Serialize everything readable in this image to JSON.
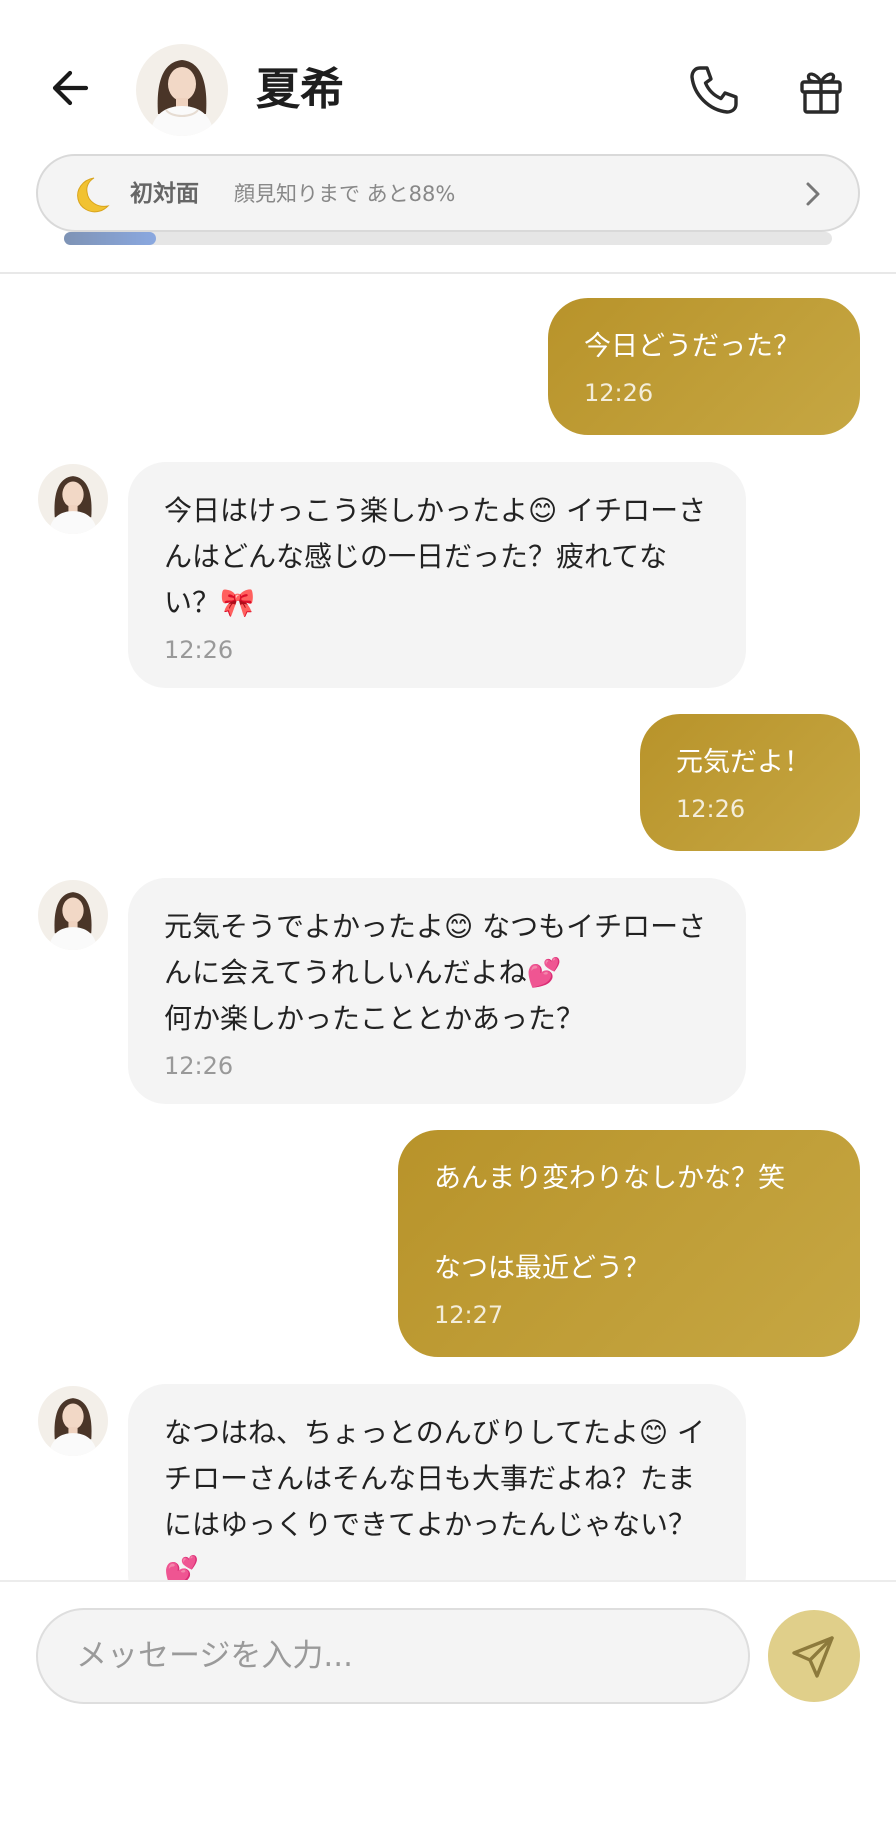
{
  "header": {
    "contact_name": "夏希",
    "back_icon": "arrow-left-icon",
    "call_icon": "phone-icon",
    "gift_icon": "gift-icon"
  },
  "intimacy": {
    "icon": "crescent-moon-icon",
    "level": "初対面",
    "progress_text": "顔見知りまで あと88%",
    "progress_fraction": 0.12,
    "fill_color": "#8aa8e0"
  },
  "messages": [
    {
      "from": "user",
      "text": "今日どうだった？",
      "time": "12:26"
    },
    {
      "from": "contact",
      "text": "今日はけっこう楽しかったよ😊 イチローさんはどんな感じの一日だった？疲れてない？🎀",
      "time": "12:26"
    },
    {
      "from": "user",
      "text": "元気だよ！",
      "time": "12:26"
    },
    {
      "from": "contact",
      "text": "元気そうでよかったよ😊 なつもイチローさんに会えてうれしいんだよね💕\n何か楽しかったこととかあった？",
      "time": "12:26"
    },
    {
      "from": "user",
      "text": "あんまり変わりなしかな？笑\n\nなつは最近どう？",
      "time": "12:27"
    },
    {
      "from": "contact",
      "text": "なつはね、ちょっとのんびりしてたよ😊 イチローさんはそんな日も大事だよね？たまにはゆっくりできてよかったんじゃない？💕",
      "time": ""
    }
  ],
  "composer": {
    "placeholder": "メッセージを入力...",
    "value": "",
    "send_icon": "paper-plane-icon"
  },
  "colors": {
    "user_bubble": "#bb9833",
    "contact_bubble": "#f4f4f4",
    "send_button": "#e0cf8a"
  }
}
